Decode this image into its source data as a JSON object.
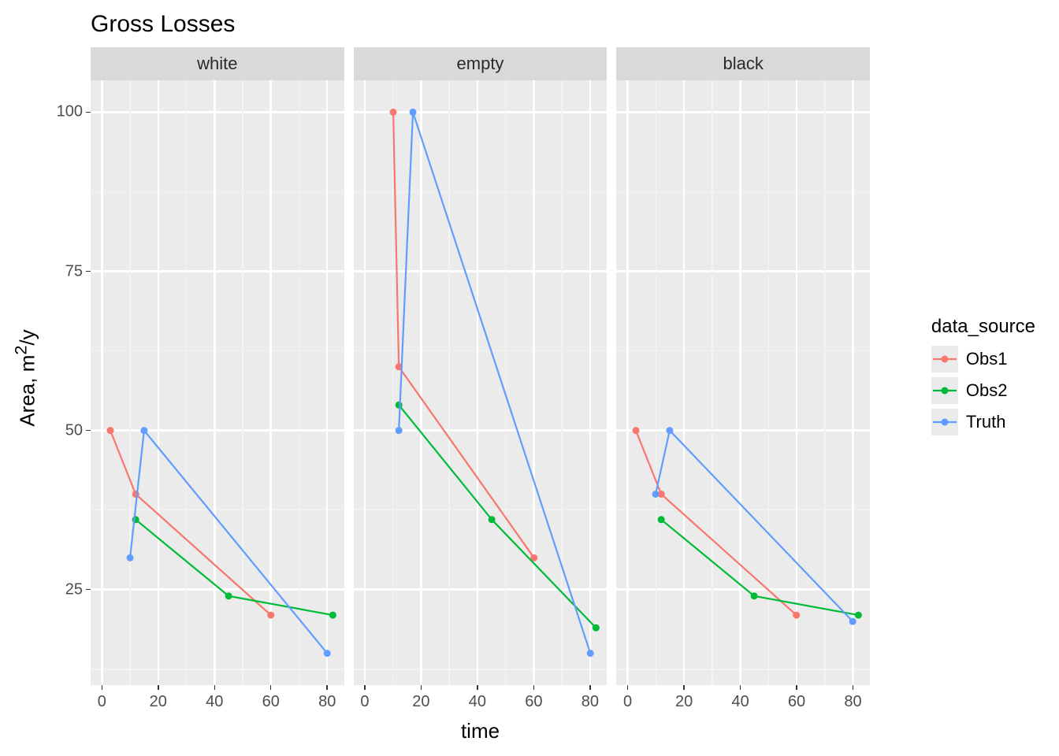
{
  "title": "Gross Losses",
  "ylabel_pre": "Area, m",
  "ylabel_sup": "2",
  "ylabel_post": "/y",
  "xlabel": "time",
  "legend_title": "data_source",
  "facets": [
    "white",
    "empty",
    "black"
  ],
  "ylim": [
    10,
    105
  ],
  "yticks": [
    25,
    50,
    75,
    100
  ],
  "xlim": [
    -4,
    86
  ],
  "xticks": [
    0,
    20,
    40,
    60,
    80
  ],
  "colors": {
    "Obs1": "#F8766D",
    "Obs2": "#00BA38",
    "Truth": "#619CFF"
  },
  "legend_series": [
    "Obs1",
    "Obs2",
    "Truth"
  ],
  "chart_data": [
    {
      "facet": "white",
      "type": "line",
      "xlabel": "time",
      "ylabel": "Area, m^2/y",
      "xlim": [
        -4,
        86
      ],
      "ylim": [
        10,
        105
      ],
      "series": [
        {
          "name": "Obs1",
          "x": [
            3,
            12,
            60
          ],
          "y": [
            50,
            40,
            21
          ]
        },
        {
          "name": "Obs2",
          "x": [
            12,
            45,
            82
          ],
          "y": [
            36,
            24,
            21
          ]
        },
        {
          "name": "Truth",
          "x": [
            10,
            15,
            80
          ],
          "y": [
            30,
            50,
            15
          ]
        }
      ]
    },
    {
      "facet": "empty",
      "type": "line",
      "xlabel": "time",
      "ylabel": "Area, m^2/y",
      "xlim": [
        -4,
        86
      ],
      "ylim": [
        10,
        105
      ],
      "series": [
        {
          "name": "Obs1",
          "x": [
            10,
            12,
            60
          ],
          "y": [
            100,
            60,
            30
          ]
        },
        {
          "name": "Obs2",
          "x": [
            12,
            45,
            82
          ],
          "y": [
            54,
            36,
            19
          ]
        },
        {
          "name": "Truth",
          "x": [
            12,
            17,
            80
          ],
          "y": [
            50,
            100,
            15
          ]
        }
      ]
    },
    {
      "facet": "black",
      "type": "line",
      "xlabel": "time",
      "ylabel": "Area, m^2/y",
      "xlim": [
        -4,
        86
      ],
      "ylim": [
        10,
        105
      ],
      "series": [
        {
          "name": "Obs1",
          "x": [
            3,
            12,
            60
          ],
          "y": [
            50,
            40,
            21
          ]
        },
        {
          "name": "Obs2",
          "x": [
            12,
            45,
            82
          ],
          "y": [
            36,
            24,
            21
          ]
        },
        {
          "name": "Truth",
          "x": [
            10,
            15,
            80
          ],
          "y": [
            40,
            50,
            20
          ]
        }
      ]
    }
  ]
}
